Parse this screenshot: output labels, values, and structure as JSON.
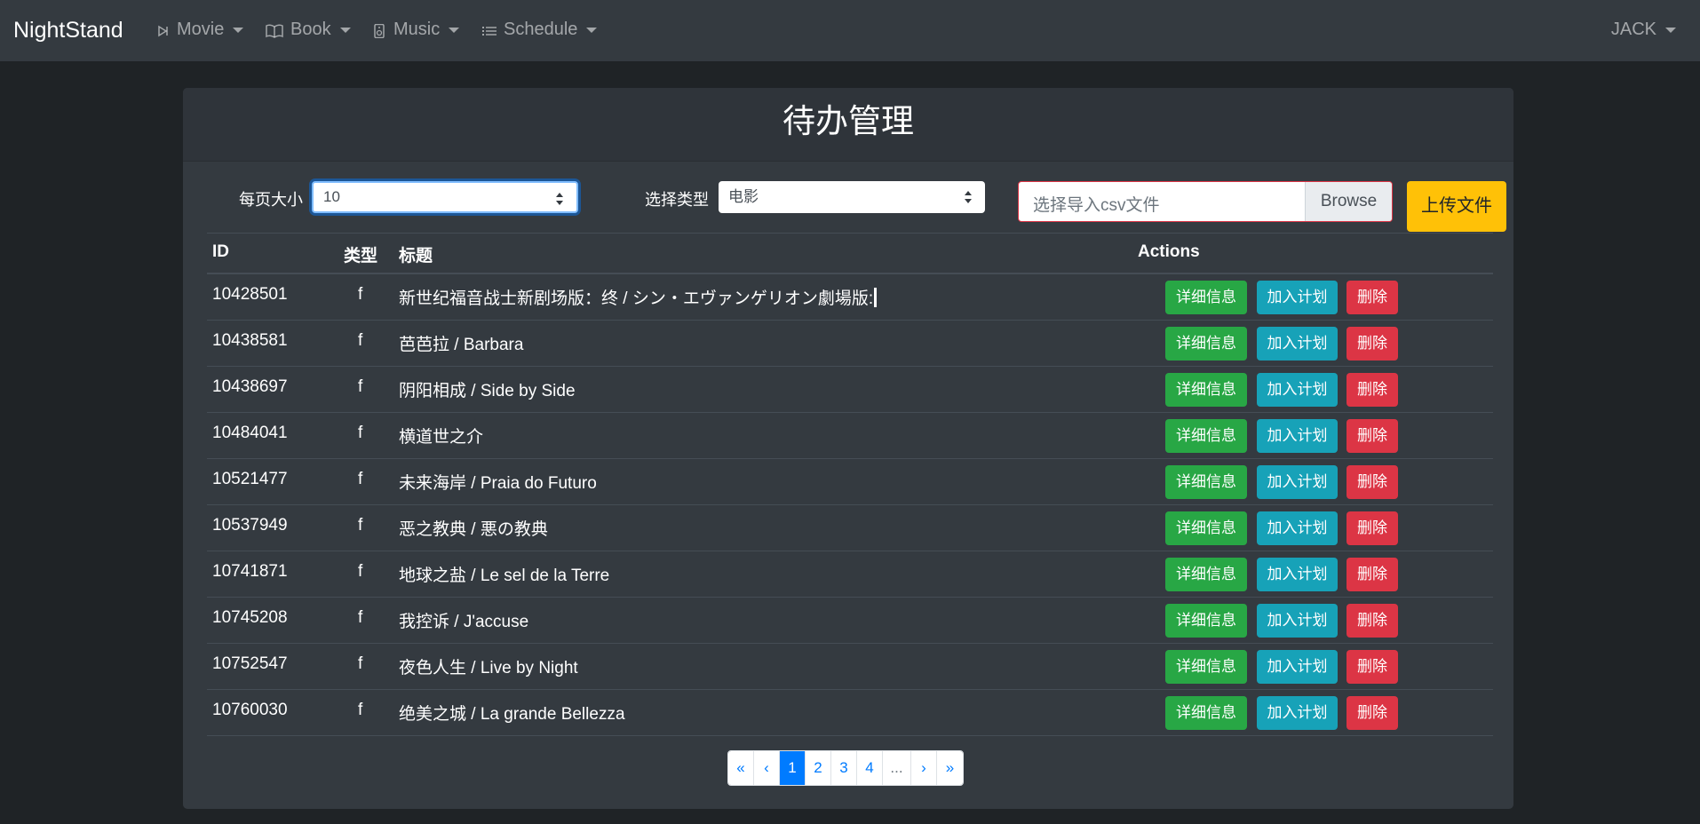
{
  "navbar": {
    "brand": "NightStand",
    "menus": [
      {
        "label": "Movie",
        "icon": "play-icon"
      },
      {
        "label": "Book",
        "icon": "book-icon"
      },
      {
        "label": "Music",
        "icon": "speaker-icon"
      },
      {
        "label": "Schedule",
        "icon": "list-icon"
      }
    ],
    "user": "JACK"
  },
  "page": {
    "title": "待办管理"
  },
  "controls": {
    "page_size_label": "每页大小",
    "page_size_value": "10",
    "type_label": "选择类型",
    "type_value": "电影",
    "file_placeholder": "选择导入csv文件",
    "browse_label": "Browse",
    "upload_label": "上传文件"
  },
  "table": {
    "headers": {
      "id": "ID",
      "type": "类型",
      "title": "标题",
      "actions": "Actions"
    },
    "action_labels": {
      "detail": "详细信息",
      "plan": "加入计划",
      "delete": "删除"
    },
    "rows": [
      {
        "id": "10428501",
        "type": "f",
        "title": "新世纪福音战士新剧场版：终 / シン・エヴァンゲリオン劇場版:"
      },
      {
        "id": "10438581",
        "type": "f",
        "title": "芭芭拉 / Barbara"
      },
      {
        "id": "10438697",
        "type": "f",
        "title": "阴阳相成 / Side by Side"
      },
      {
        "id": "10484041",
        "type": "f",
        "title": "横道世之介"
      },
      {
        "id": "10521477",
        "type": "f",
        "title": "未来海岸 / Praia do Futuro"
      },
      {
        "id": "10537949",
        "type": "f",
        "title": "恶之教典 / 悪の教典"
      },
      {
        "id": "10741871",
        "type": "f",
        "title": "地球之盐 / Le sel de la Terre"
      },
      {
        "id": "10745208",
        "type": "f",
        "title": "我控诉 / J'accuse"
      },
      {
        "id": "10752547",
        "type": "f",
        "title": "夜色人生 / Live by Night"
      },
      {
        "id": "10760030",
        "type": "f",
        "title": "绝美之城 / La grande Bellezza"
      }
    ]
  },
  "pagination": {
    "first": "«",
    "prev": "‹",
    "pages": [
      "1",
      "2",
      "3",
      "4"
    ],
    "ellipsis": "...",
    "next": "›",
    "last": "»",
    "active": "1"
  }
}
